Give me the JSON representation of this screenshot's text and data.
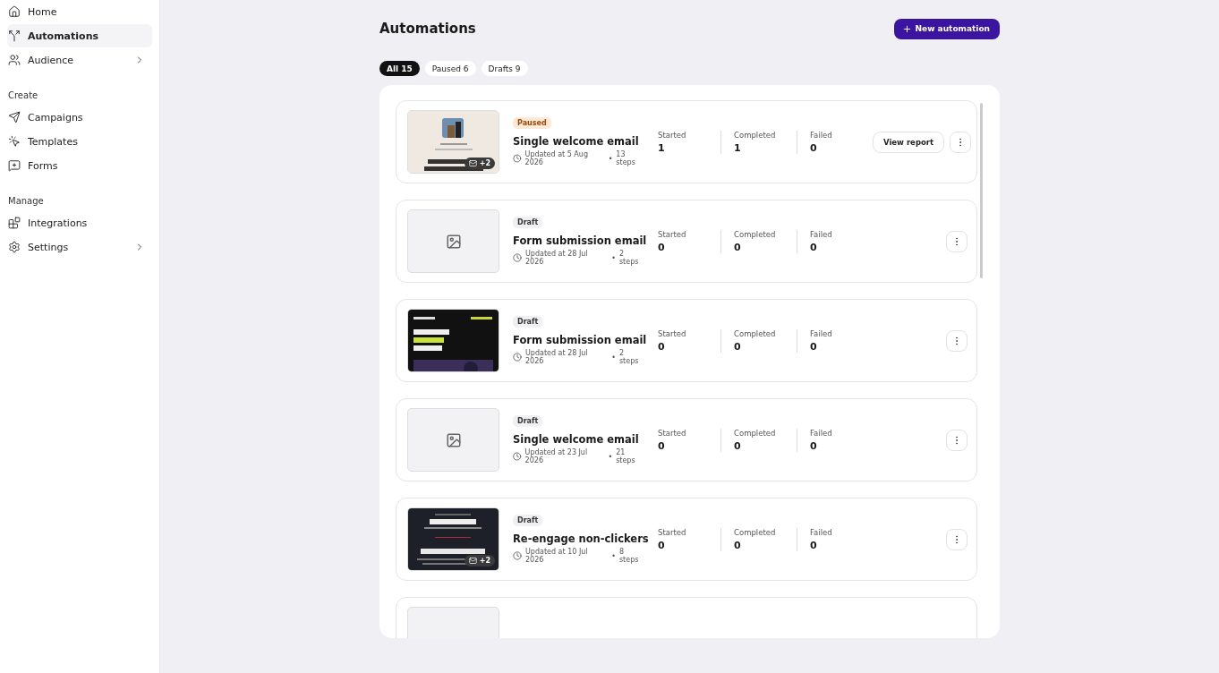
{
  "sidebar": {
    "groups": [
      {
        "items": [
          {
            "label": "Home",
            "selected": false,
            "expandable": false
          },
          {
            "label": "Automations",
            "selected": true,
            "expandable": false
          },
          {
            "label": "Audience",
            "selected": false,
            "expandable": true
          }
        ]
      },
      {
        "heading": "Create",
        "items": [
          {
            "label": "Campaigns",
            "selected": false,
            "expandable": false
          },
          {
            "label": "Templates",
            "selected": false,
            "expandable": false
          },
          {
            "label": "Forms",
            "selected": false,
            "expandable": false
          }
        ]
      },
      {
        "heading": "Manage",
        "items": [
          {
            "label": "Integrations",
            "selected": false,
            "expandable": false
          },
          {
            "label": "Settings",
            "selected": false,
            "expandable": true
          }
        ]
      }
    ]
  },
  "page": {
    "title": "Automations",
    "new_button": "New automation"
  },
  "filters": [
    {
      "label": "All 15",
      "selected": true
    },
    {
      "label": "Paused 6",
      "selected": false
    },
    {
      "label": "Drafts 9",
      "selected": false
    }
  ],
  "automations": [
    {
      "status": {
        "label": "Paused",
        "kind": "paused"
      },
      "title": "Single welcome email",
      "updated": "Updated at 5 Aug 2026",
      "steps": "13 steps",
      "separator": "•",
      "thumbnail": {
        "kind": "picture",
        "extra": "+2"
      },
      "stats": [
        {
          "label": "Started",
          "value": "1"
        },
        {
          "label": "Completed",
          "value": "1"
        },
        {
          "label": "Failed",
          "value": "0"
        }
      ],
      "report_button": "View report"
    },
    {
      "status": {
        "label": "Draft",
        "kind": "draft"
      },
      "title": "Form submission email",
      "updated": "Updated at 28 Jul 2026",
      "steps": "2 steps",
      "separator": "•",
      "thumbnail": {
        "kind": "placeholder"
      },
      "stats": [
        {
          "label": "Started",
          "value": "0"
        },
        {
          "label": "Completed",
          "value": "0"
        },
        {
          "label": "Failed",
          "value": "0"
        }
      ]
    },
    {
      "status": {
        "label": "Draft",
        "kind": "draft"
      },
      "title": "Form submission email",
      "updated": "Updated at 28 Jul 2026",
      "steps": "2 steps",
      "separator": "•",
      "stats": [
        {
          "label": "Started",
          "value": "0"
        },
        {
          "label": "Completed",
          "value": "0"
        },
        {
          "label": "Failed",
          "value": "0"
        }
      ]
    },
    {
      "status": {
        "label": "Draft",
        "kind": "draft"
      },
      "title": "Single welcome email",
      "updated": "Updated at 23 Jul 2026",
      "steps": "21 steps",
      "separator": "•",
      "thumbnail": {
        "kind": "placeholder"
      },
      "stats": [
        {
          "label": "Started",
          "value": "0"
        },
        {
          "label": "Completed",
          "value": "0"
        },
        {
          "label": "Failed",
          "value": "0"
        }
      ]
    },
    {
      "status": {
        "label": "Draft",
        "kind": "draft"
      },
      "title": "Re-engage non-clickers",
      "updated": "Updated at 10 Jul 2026",
      "steps": "8 steps",
      "separator": "•",
      "thumbnail": {
        "kind": "picture",
        "extra": "+2"
      },
      "stats": [
        {
          "label": "Started",
          "value": "0"
        },
        {
          "label": "Completed",
          "value": "0"
        },
        {
          "label": "Failed",
          "value": "0"
        }
      ]
    }
  ]
}
